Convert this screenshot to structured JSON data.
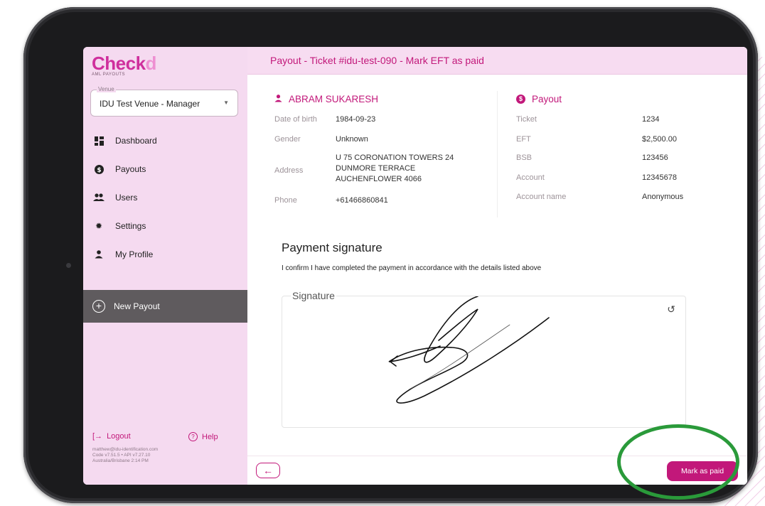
{
  "brand": {
    "name_main": "Check",
    "name_accent": "d",
    "subtitle": "AML PAYOUTS"
  },
  "venue": {
    "label": "Venue",
    "value": "IDU Test Venue - Manager"
  },
  "nav": [
    {
      "label": "Dashboard",
      "icon": "dashboard-icon"
    },
    {
      "label": "Payouts",
      "icon": "dollar-circle-icon"
    },
    {
      "label": "Users",
      "icon": "users-icon"
    },
    {
      "label": "Settings",
      "icon": "gear-icon"
    },
    {
      "label": "My Profile",
      "icon": "person-icon"
    }
  ],
  "new_payout": {
    "label": "New Payout"
  },
  "footer": {
    "logout": "Logout",
    "help": "Help",
    "email": "matthew@idu-identification.com",
    "version": "Code v7.51.5 • API v7.27.10",
    "locale_time": "Australia/Brisbane 2:14 PM"
  },
  "header": {
    "title": "Payout - Ticket #idu-test-090 - Mark EFT as paid"
  },
  "person": {
    "name": "ABRAM SUKARESH",
    "fields": [
      {
        "label": "Date of birth",
        "value": "1984-09-23"
      },
      {
        "label": "Gender",
        "value": "Unknown"
      },
      {
        "label": "Address",
        "lines": [
          "U 75 CORONATION TOWERS 24",
          "DUNMORE TERRACE",
          "AUCHENFLOWER 4066"
        ]
      },
      {
        "label": "Phone",
        "value": "+61466860841"
      }
    ]
  },
  "payout": {
    "title": "Payout",
    "fields": [
      {
        "label": "Ticket",
        "value": "1234"
      },
      {
        "label": "EFT",
        "value": "$2,500.00"
      },
      {
        "label": "BSB",
        "value": "123456"
      },
      {
        "label": "Account",
        "value": "12345678"
      },
      {
        "label": "Account name",
        "value": "Anonymous"
      }
    ]
  },
  "signature": {
    "title": "Payment signature",
    "confirm": "I confirm I have completed the payment in accordance with the details listed above",
    "label": "Signature"
  },
  "actions": {
    "back": "←",
    "mark_paid": "Mark as paid"
  },
  "colors": {
    "accent": "#c2187a",
    "sidebar_bg": "#f5daf0",
    "highlight": "#2a9a3a"
  }
}
